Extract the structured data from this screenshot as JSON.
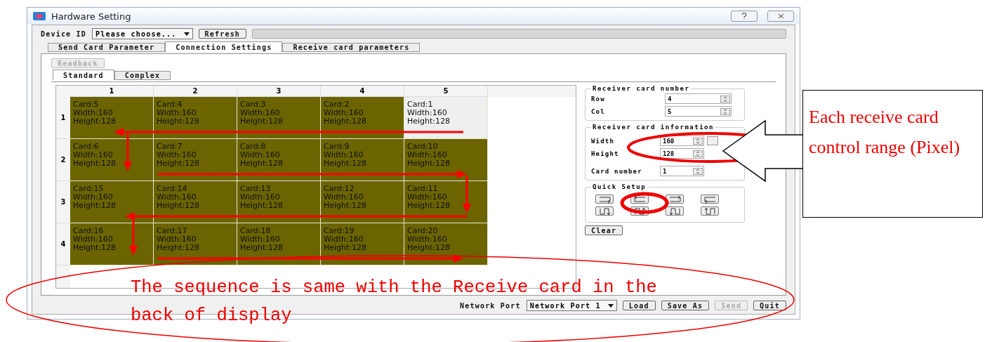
{
  "window": {
    "title": "Hardware Setting"
  },
  "device_bar": {
    "label": "Device ID",
    "select_value": "Please choose...",
    "refresh_button": "Refresh",
    "progress": {
      "level": 0
    }
  },
  "tabs": [
    {
      "label": "Send Card Parameter",
      "selected": false
    },
    {
      "label": "Connection Settings",
      "selected": true
    },
    {
      "label": "Receive card parameters",
      "selected": false
    }
  ],
  "readback_button": {
    "label": "Readback",
    "disabled": true
  },
  "subtabs": [
    {
      "label": "Standard",
      "selected": true
    },
    {
      "label": "Complex",
      "selected": false
    }
  ],
  "grid": {
    "columns": [
      "1",
      "2",
      "3",
      "4",
      "5"
    ],
    "rows": [
      {
        "header": "1",
        "cells": [
          {
            "card": "Card:5",
            "width": "Width:160",
            "height": "Height:128",
            "selected": false
          },
          {
            "card": "Card:4",
            "width": "Width:160",
            "height": "Height:128",
            "selected": false
          },
          {
            "card": "Card:3",
            "width": "Width:160",
            "height": "Height:128",
            "selected": false
          },
          {
            "card": "Card:2",
            "width": "Width:160",
            "height": "Height:128",
            "selected": false
          },
          {
            "card": "Card:1",
            "width": "Width:160",
            "height": "Height:128",
            "selected": true
          }
        ]
      },
      {
        "header": "2",
        "cells": [
          {
            "card": "Card:6",
            "width": "Width:160",
            "height": "Height:128",
            "selected": false
          },
          {
            "card": "Card:7",
            "width": "Width:160",
            "height": "Height:128",
            "selected": false
          },
          {
            "card": "Card:8",
            "width": "Width:160",
            "height": "Height:128",
            "selected": false
          },
          {
            "card": "Card:9",
            "width": "Width:160",
            "height": "Height:128",
            "selected": false
          },
          {
            "card": "Card:10",
            "width": "Width:160",
            "height": "Height:128",
            "selected": false
          }
        ]
      },
      {
        "header": "3",
        "cells": [
          {
            "card": "Card:15",
            "width": "Width:160",
            "height": "Height:128",
            "selected": false
          },
          {
            "card": "Card:14",
            "width": "Width:160",
            "height": "Height:128",
            "selected": false
          },
          {
            "card": "Card:13",
            "width": "Width:160",
            "height": "Height:128",
            "selected": false
          },
          {
            "card": "Card:12",
            "width": "Width:160",
            "height": "Height:128",
            "selected": false
          },
          {
            "card": "Card:11",
            "width": "Width:160",
            "height": "Height:128",
            "selected": false
          }
        ]
      },
      {
        "header": "4",
        "cells": [
          {
            "card": "Card:16",
            "width": "Width:160",
            "height": "Height:128",
            "selected": false
          },
          {
            "card": "Card:17",
            "width": "Width:160",
            "height": "Height:128",
            "selected": false
          },
          {
            "card": "Card:18",
            "width": "Width:160",
            "height": "Height:128",
            "selected": false
          },
          {
            "card": "Card:19",
            "width": "Width:160",
            "height": "Height:128",
            "selected": false
          },
          {
            "card": "Card:20",
            "width": "Width:160",
            "height": "Height:128",
            "selected": false
          }
        ]
      }
    ]
  },
  "receiver_card_number": {
    "title": "Receiver card number",
    "fields": [
      {
        "label": "Row",
        "value": "4"
      },
      {
        "label": "Col",
        "value": "5"
      }
    ]
  },
  "receiver_card_information": {
    "title": "Receiver card information",
    "fields": [
      {
        "label": "Width",
        "value": "160",
        "extra_button": true
      },
      {
        "label": "Height",
        "value": "128",
        "extra_button": false
      },
      {
        "label": "Card number",
        "value": "1",
        "extra_button": false
      }
    ]
  },
  "quick_setup": {
    "title": "Quick Setup",
    "buttons": [
      {
        "kind": "h-right"
      },
      {
        "kind": "h-left"
      },
      {
        "kind": "h-right-up"
      },
      {
        "kind": "h-left-up"
      },
      {
        "kind": "v-down"
      },
      {
        "kind": "v-up"
      },
      {
        "kind": "v-down-left"
      },
      {
        "kind": "v-up-left"
      }
    ]
  },
  "clear_button": "Clear",
  "bottom_bar": {
    "label": "Network Port",
    "select_value": "Network Port 1",
    "buttons": [
      {
        "label": "Load",
        "disabled": false
      },
      {
        "label": "Save As",
        "disabled": false
      },
      {
        "label": "Send",
        "disabled": true
      },
      {
        "label": "Quit",
        "disabled": false
      }
    ]
  },
  "annotations": {
    "callout": "Each receive card control range (Pixel)",
    "note_lines": [
      "The sequence is same with the Receive card in the",
      "back of display"
    ]
  }
}
